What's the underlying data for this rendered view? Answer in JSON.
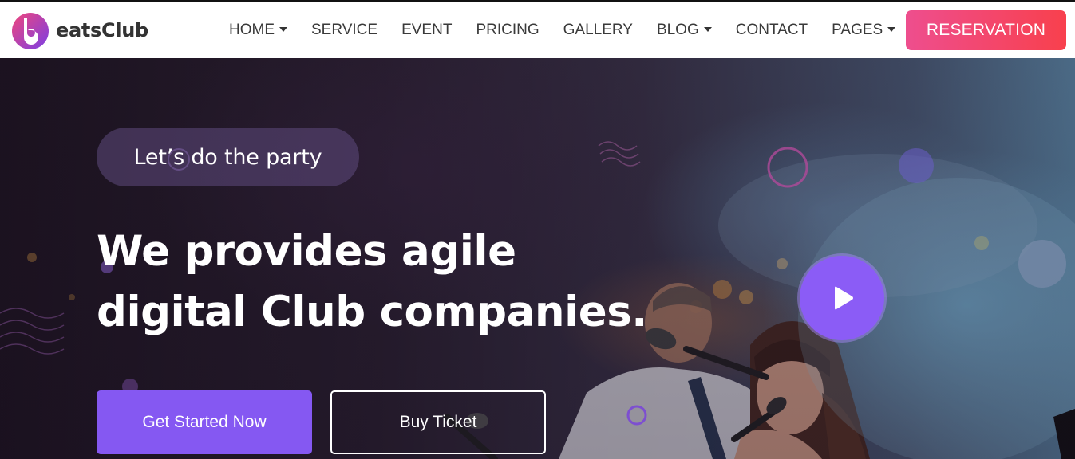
{
  "brand": {
    "name": "eatsClub",
    "logo_icon": "b-logo-icon"
  },
  "nav": {
    "items": [
      {
        "label": "HOME",
        "dropdown": true
      },
      {
        "label": "SERVICE",
        "dropdown": false
      },
      {
        "label": "EVENT",
        "dropdown": false
      },
      {
        "label": "PRICING",
        "dropdown": false
      },
      {
        "label": "GALLERY",
        "dropdown": false
      },
      {
        "label": "BLOG",
        "dropdown": true
      },
      {
        "label": "CONTACT",
        "dropdown": false
      },
      {
        "label": "PAGES",
        "dropdown": true
      }
    ],
    "cta_label": "RESERVATION"
  },
  "hero": {
    "tag": "Let’s do the party",
    "headline_line1": "We provides agile",
    "headline_line2": "digital Club companies.",
    "primary_button": "Get Started Now",
    "secondary_button": "Buy Ticket",
    "play_icon": "play-icon"
  },
  "colors": {
    "accent_purple": "#8558f2",
    "reservation_start": "#ee4e8e",
    "reservation_end": "#f8404d",
    "logo_pink": "#ec407a",
    "logo_purple": "#7b3fe4"
  }
}
